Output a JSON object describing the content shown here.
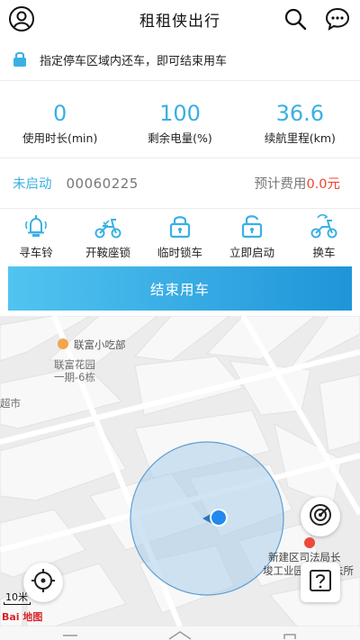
{
  "header": {
    "title": "租租侠出行",
    "icons": [
      "profile-icon",
      "search-icon",
      "message-icon"
    ]
  },
  "notice": {
    "icon": "lock-icon",
    "text": "指定停车区域内还车，即可结束用车"
  },
  "stats": [
    {
      "value": "0",
      "label": "使用时长(min)"
    },
    {
      "value": "100",
      "label": "剩余电量(%)"
    },
    {
      "value": "36.6",
      "label": "续航里程(km)"
    }
  ],
  "status": {
    "state": "未启动",
    "code": "00060225",
    "fee_label": "预计费用",
    "fee_amount": "0.0元"
  },
  "actions": [
    {
      "label": "寻车铃",
      "icon": "bell-icon"
    },
    {
      "label": "开鞍座锁",
      "icon": "scooter-seat-icon"
    },
    {
      "label": "临时锁车",
      "icon": "lock-icon"
    },
    {
      "label": "立即启动",
      "icon": "unlock-icon"
    },
    {
      "label": "换车",
      "icon": "scooter-swap-icon"
    }
  ],
  "end_button": "结束用车",
  "map": {
    "labels": {
      "restaurant": "联富小吃部",
      "garden1": "联富花园",
      "garden2": "一期-6栋",
      "left_edge": "超市",
      "poi1": "新建区司法局长",
      "poi2": "埈工业园",
      "poi3": "法所"
    },
    "scale": "10米",
    "logo": "Bai 地图"
  },
  "colors": {
    "accent": "#3ab0e3",
    "fee": "#f0452d",
    "button_start": "#52c4f0",
    "button_end": "#1f95d8"
  }
}
